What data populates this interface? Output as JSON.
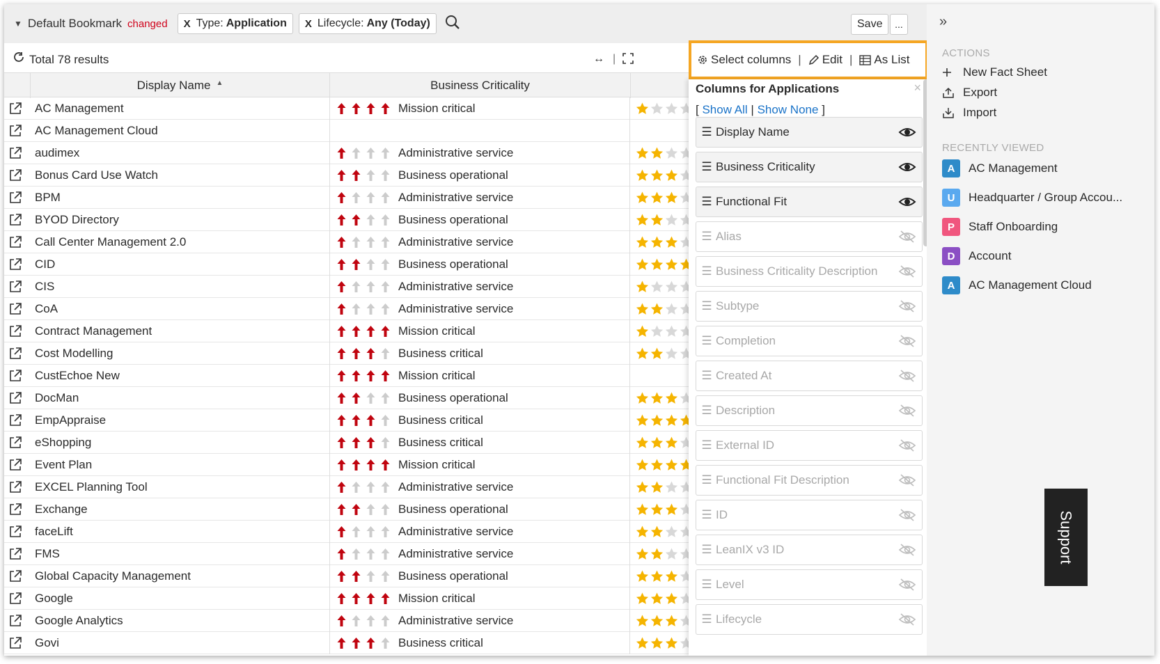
{
  "bookmark": {
    "title": "Default Bookmark",
    "changed_label": "changed",
    "filters": [
      {
        "remove": "X",
        "label": "Type:",
        "value": "Application"
      },
      {
        "remove": "X",
        "label": "Lifecycle:",
        "value": "Any (Today)"
      }
    ],
    "save_label": "Save",
    "more_label": "..."
  },
  "results": {
    "text": "Total 78 results"
  },
  "toolbar": {
    "select_columns": "Select columns",
    "edit": "Edit",
    "as_list": "As List",
    "sep": "|"
  },
  "table": {
    "columns": [
      "Display Name",
      "Business Criticality"
    ],
    "sort_indicator": "▲",
    "rows": [
      {
        "name": "AC Management",
        "crit": "Mission critical",
        "level": 4,
        "fit": 1
      },
      {
        "name": "AC Management Cloud",
        "crit": "",
        "level": 0,
        "fit": 0
      },
      {
        "name": "audimex",
        "crit": "Administrative service",
        "level": 1,
        "fit": 2
      },
      {
        "name": "Bonus Card Use Watch",
        "crit": "Business operational",
        "level": 2,
        "fit": 3
      },
      {
        "name": "BPM",
        "crit": "Administrative service",
        "level": 1,
        "fit": 3
      },
      {
        "name": "BYOD Directory",
        "crit": "Business operational",
        "level": 2,
        "fit": 2
      },
      {
        "name": "Call Center Management 2.0",
        "crit": "Administrative service",
        "level": 1,
        "fit": 3
      },
      {
        "name": "CID",
        "crit": "Business operational",
        "level": 2,
        "fit": 4
      },
      {
        "name": "CIS",
        "crit": "Administrative service",
        "level": 1,
        "fit": 1
      },
      {
        "name": "CoA",
        "crit": "Administrative service",
        "level": 1,
        "fit": 2
      },
      {
        "name": "Contract Management",
        "crit": "Mission critical",
        "level": 4,
        "fit": 1
      },
      {
        "name": "Cost Modelling",
        "crit": "Business critical",
        "level": 3,
        "fit": 2
      },
      {
        "name": "CustEchoe New",
        "crit": "Mission critical",
        "level": 4,
        "fit": 0
      },
      {
        "name": "DocMan",
        "crit": "Business operational",
        "level": 2,
        "fit": 3
      },
      {
        "name": "EmpAppraise",
        "crit": "Business critical",
        "level": 3,
        "fit": 4
      },
      {
        "name": "eShopping",
        "crit": "Business critical",
        "level": 3,
        "fit": 3
      },
      {
        "name": "Event Plan",
        "crit": "Mission critical",
        "level": 4,
        "fit": 4
      },
      {
        "name": "EXCEL Planning Tool",
        "crit": "Administrative service",
        "level": 1,
        "fit": 2
      },
      {
        "name": "Exchange",
        "crit": "Business operational",
        "level": 2,
        "fit": 3
      },
      {
        "name": "faceLift",
        "crit": "Administrative service",
        "level": 1,
        "fit": 2
      },
      {
        "name": "FMS",
        "crit": "Administrative service",
        "level": 1,
        "fit": 2
      },
      {
        "name": "Global Capacity Management",
        "crit": "Business operational",
        "level": 2,
        "fit": 3
      },
      {
        "name": "Google",
        "crit": "Mission critical",
        "level": 4,
        "fit": 3
      },
      {
        "name": "Google Analytics",
        "crit": "Administrative service",
        "level": 1,
        "fit": 3
      },
      {
        "name": "Govi",
        "crit": "Business critical",
        "level": 3,
        "fit": 3
      }
    ]
  },
  "column_panel": {
    "title": "Columns for Applications",
    "close": "×",
    "bracket_open": "[",
    "bracket_close": "]",
    "show_all": "Show All",
    "divider": "|",
    "show_none": "Show None",
    "columns": [
      {
        "label": "Display Name",
        "visible": true
      },
      {
        "label": "Business Criticality",
        "visible": true
      },
      {
        "label": "Functional Fit",
        "visible": true
      },
      {
        "label": "Alias",
        "visible": false
      },
      {
        "label": "Business Criticality Description",
        "visible": false
      },
      {
        "label": "Subtype",
        "visible": false
      },
      {
        "label": "Completion",
        "visible": false
      },
      {
        "label": "Created At",
        "visible": false
      },
      {
        "label": "Description",
        "visible": false
      },
      {
        "label": "External ID",
        "visible": false
      },
      {
        "label": "Functional Fit Description",
        "visible": false
      },
      {
        "label": "ID",
        "visible": false
      },
      {
        "label": "LeanIX v3 ID",
        "visible": false
      },
      {
        "label": "Level",
        "visible": false
      },
      {
        "label": "Lifecycle",
        "visible": false
      }
    ]
  },
  "sidebar": {
    "actions_title": "ACTIONS",
    "actions": [
      {
        "label": "New Fact Sheet",
        "icon": "plus-icon"
      },
      {
        "label": "Export",
        "icon": "export-icon"
      },
      {
        "label": "Import",
        "icon": "import-icon"
      }
    ],
    "recent_title": "RECENTLY VIEWED",
    "recent": [
      {
        "letter": "A",
        "label": "AC Management",
        "color": "#2e8bc9"
      },
      {
        "letter": "U",
        "label": "Headquarter / Group Accou...",
        "color": "#5aa9ef"
      },
      {
        "letter": "P",
        "label": "Staff Onboarding",
        "color": "#f0567e"
      },
      {
        "letter": "D",
        "label": "Account",
        "color": "#8b4fc4"
      },
      {
        "letter": "A",
        "label": "AC Management Cloud",
        "color": "#2e8bc9"
      }
    ]
  },
  "support": {
    "label": "Support"
  },
  "colors": {
    "arrow_active": "#c0040f",
    "arrow_inactive": "#cccccc",
    "star_active": "#f5b400",
    "star_inactive": "#d8d8d8",
    "highlight": "#f5a623"
  }
}
